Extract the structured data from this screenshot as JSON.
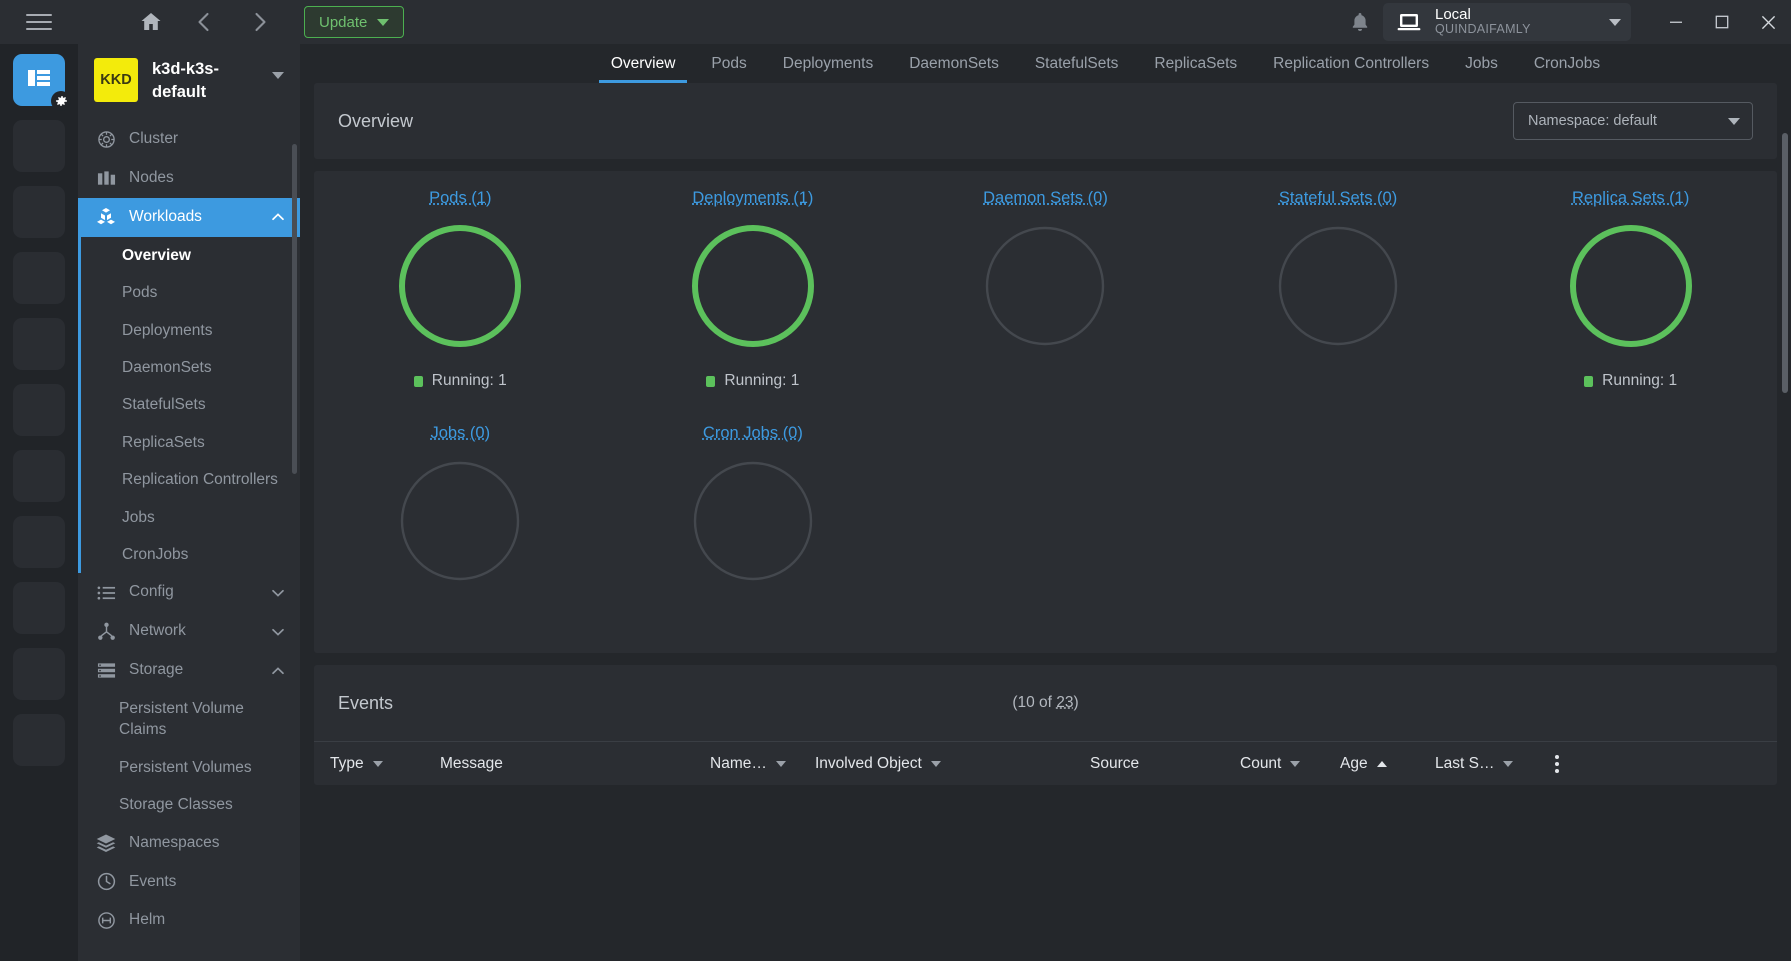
{
  "titlebar": {
    "hamburger_icon": "hamburger-icon",
    "home_icon": "home-icon",
    "back_icon": "arrow-left-icon",
    "forward_icon": "arrow-right-icon",
    "update_label": "Update",
    "bell_icon": "bell-icon",
    "cluster_name": "Local",
    "cluster_sub": "QUINDAIFAMLY",
    "laptop_icon": "laptop-icon",
    "minimize_label": "–",
    "maximize_label": "☐",
    "close_label": "✕"
  },
  "rail": {
    "items": [
      {
        "name": "dashboard-app",
        "active": true,
        "icon": "table-icon",
        "badge": "gear-icon"
      },
      {
        "name": "rail-slot-2",
        "active": false
      },
      {
        "name": "rail-slot-3",
        "active": false
      },
      {
        "name": "rail-slot-4",
        "active": false
      },
      {
        "name": "rail-slot-5",
        "active": false
      },
      {
        "name": "rail-slot-6",
        "active": false
      },
      {
        "name": "rail-slot-7",
        "active": false
      },
      {
        "name": "rail-slot-8",
        "active": false
      },
      {
        "name": "rail-slot-9",
        "active": false
      },
      {
        "name": "rail-slot-10",
        "active": false
      },
      {
        "name": "rail-slot-11",
        "active": false
      }
    ]
  },
  "sidebar": {
    "avatar_initials": "KKD",
    "cluster_title": "k3d-k3s-default",
    "nav": [
      {
        "label": "Cluster",
        "icon": "helm-wheel-icon",
        "active": false,
        "expandable": false
      },
      {
        "label": "Nodes",
        "icon": "servers-icon",
        "active": false,
        "expandable": false
      },
      {
        "label": "Workloads",
        "icon": "cubes-icon",
        "active": true,
        "expandable": true,
        "expanded": true
      },
      {
        "label": "Config",
        "icon": "list-icon",
        "active": false,
        "expandable": true,
        "expanded": false
      },
      {
        "label": "Network",
        "icon": "network-icon",
        "active": false,
        "expandable": true,
        "expanded": false
      },
      {
        "label": "Storage",
        "icon": "storage-icon",
        "active": false,
        "expandable": true,
        "expanded": true
      },
      {
        "label": "Namespaces",
        "icon": "layers-icon",
        "active": false,
        "expandable": false
      },
      {
        "label": "Events",
        "icon": "clock-icon",
        "active": false,
        "expandable": false
      },
      {
        "label": "Helm",
        "icon": "helm-icon",
        "active": false,
        "expandable": false
      }
    ],
    "workloads_children": [
      {
        "label": "Overview",
        "current": true
      },
      {
        "label": "Pods",
        "current": false
      },
      {
        "label": "Deployments",
        "current": false
      },
      {
        "label": "DaemonSets",
        "current": false
      },
      {
        "label": "StatefulSets",
        "current": false
      },
      {
        "label": "ReplicaSets",
        "current": false
      },
      {
        "label": "Replication Controllers",
        "current": false
      },
      {
        "label": "Jobs",
        "current": false
      },
      {
        "label": "CronJobs",
        "current": false
      }
    ],
    "storage_children": [
      {
        "label": "Persistent Volume Claims",
        "current": false
      },
      {
        "label": "Persistent Volumes",
        "current": false
      },
      {
        "label": "Storage Classes",
        "current": false
      }
    ]
  },
  "tabs": [
    {
      "label": "Overview",
      "active": true
    },
    {
      "label": "Pods",
      "active": false
    },
    {
      "label": "Deployments",
      "active": false
    },
    {
      "label": "DaemonSets",
      "active": false
    },
    {
      "label": "StatefulSets",
      "active": false
    },
    {
      "label": "ReplicaSets",
      "active": false
    },
    {
      "label": "Replication Controllers",
      "active": false
    },
    {
      "label": "Jobs",
      "active": false
    },
    {
      "label": "CronJobs",
      "active": false
    }
  ],
  "overview": {
    "title": "Overview",
    "namespace_label": "Namespace: default"
  },
  "chart_data": {
    "type": "pie",
    "title": "Workload Overview",
    "legend_position": "below",
    "accent_color": "#5cc15c",
    "empty_color": "#44484e",
    "link_color": "#3d9ae0",
    "charts": [
      {
        "label": "Pods (1)",
        "total": 1,
        "running": 1,
        "legend": "Running: 1",
        "has_data": true
      },
      {
        "label": "Deployments (1)",
        "total": 1,
        "running": 1,
        "legend": "Running: 1",
        "has_data": true
      },
      {
        "label": "Daemon Sets (0)",
        "total": 0,
        "running": 0,
        "legend": "",
        "has_data": false
      },
      {
        "label": "Stateful Sets (0)",
        "total": 0,
        "running": 0,
        "legend": "",
        "has_data": false
      },
      {
        "label": "Replica Sets (1)",
        "total": 1,
        "running": 1,
        "legend": "Running: 1",
        "has_data": true
      },
      {
        "label": "Jobs (0)",
        "total": 0,
        "running": 0,
        "legend": "",
        "has_data": false
      },
      {
        "label": "Cron Jobs (0)",
        "total": 0,
        "running": 0,
        "legend": "",
        "has_data": false
      }
    ]
  },
  "events": {
    "title": "Events",
    "count_prefix": "(10 of ",
    "count_total": "23",
    "count_suffix": ")",
    "columns": [
      {
        "label": "Type",
        "sort": "down"
      },
      {
        "label": "Message",
        "sort": "none"
      },
      {
        "label": "Name…",
        "sort": "down"
      },
      {
        "label": "Involved Object",
        "sort": "down"
      },
      {
        "label": "Source",
        "sort": "none"
      },
      {
        "label": "Count",
        "sort": "down"
      },
      {
        "label": "Age",
        "sort": "up"
      },
      {
        "label": "Last S…",
        "sort": "down"
      }
    ],
    "rows": []
  }
}
